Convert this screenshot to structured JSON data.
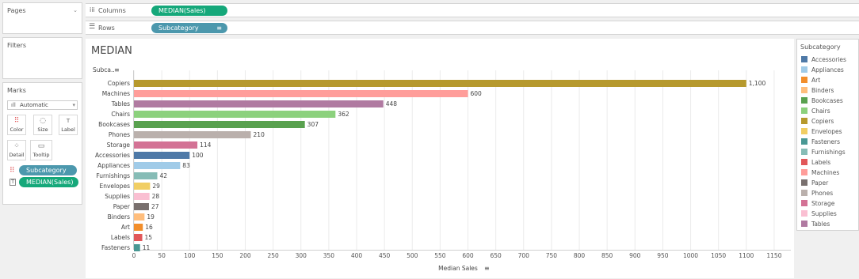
{
  "pages": {
    "label": "Pages"
  },
  "filters": {
    "label": "Filters"
  },
  "marks": {
    "label": "Marks",
    "type_dropdown": "Automatic",
    "buttons": {
      "color": "Color",
      "size": "Size",
      "label": "Label",
      "detail": "Detail",
      "tooltip": "Tooltip"
    },
    "fields": [
      {
        "name": "Subcategory"
      },
      {
        "name": "MEDIAN(Sales)"
      }
    ]
  },
  "shelves": {
    "columns_label": "Columns",
    "columns_pill": "MEDIAN(Sales)",
    "rows_label": "Rows",
    "rows_pill": "Subcategory"
  },
  "legend": {
    "title": "Subcategory",
    "items": [
      {
        "name": "Accessories",
        "color": "#4e79a7"
      },
      {
        "name": "Appliances",
        "color": "#a0cbe8"
      },
      {
        "name": "Art",
        "color": "#f28e2b"
      },
      {
        "name": "Binders",
        "color": "#ffbe7d"
      },
      {
        "name": "Bookcases",
        "color": "#59a14f"
      },
      {
        "name": "Chairs",
        "color": "#8cd17d"
      },
      {
        "name": "Copiers",
        "color": "#b6992d"
      },
      {
        "name": "Envelopes",
        "color": "#f1ce63"
      },
      {
        "name": "Fasteners",
        "color": "#499894"
      },
      {
        "name": "Furnishings",
        "color": "#86bcb6"
      },
      {
        "name": "Labels",
        "color": "#e15759"
      },
      {
        "name": "Machines",
        "color": "#ff9d9a"
      },
      {
        "name": "Paper",
        "color": "#79706e"
      },
      {
        "name": "Phones",
        "color": "#bab0ac"
      },
      {
        "name": "Storage",
        "color": "#d37295"
      },
      {
        "name": "Supplies",
        "color": "#fabfd2"
      },
      {
        "name": "Tables",
        "color": "#b07aa1"
      }
    ]
  },
  "chart_data": {
    "type": "bar",
    "orientation": "horizontal",
    "title": "MEDIAN",
    "row_header": "Subca..",
    "xlabel": "Median Sales",
    "xlim": [
      0,
      1180
    ],
    "x_ticks": [
      0,
      50,
      100,
      150,
      200,
      250,
      300,
      350,
      400,
      450,
      500,
      550,
      600,
      650,
      700,
      750,
      800,
      850,
      900,
      950,
      1000,
      1050,
      1100,
      1150
    ],
    "grid": true,
    "categories": [
      "Copiers",
      "Machines",
      "Tables",
      "Chairs",
      "Bookcases",
      "Phones",
      "Storage",
      "Accessories",
      "Appliances",
      "Furnishings",
      "Envelopes",
      "Supplies",
      "Paper",
      "Binders",
      "Art",
      "Labels",
      "Fasteners"
    ],
    "values": [
      1100,
      600,
      448,
      362,
      307,
      210,
      114,
      100,
      83,
      42,
      29,
      28,
      27,
      19,
      16,
      15,
      11
    ],
    "value_labels": [
      "1,100",
      "600",
      "448",
      "362",
      "307",
      "210",
      "114",
      "100",
      "83",
      "42",
      "29",
      "28",
      "27",
      "19",
      "16",
      "15",
      "11"
    ],
    "colors": [
      "#b6992d",
      "#ff9d9a",
      "#b07aa1",
      "#8cd17d",
      "#59a14f",
      "#bab0ac",
      "#d37295",
      "#4e79a7",
      "#a0cbe8",
      "#86bcb6",
      "#f1ce63",
      "#fabfd2",
      "#79706e",
      "#ffbe7d",
      "#f28e2b",
      "#e15759",
      "#499894"
    ]
  }
}
